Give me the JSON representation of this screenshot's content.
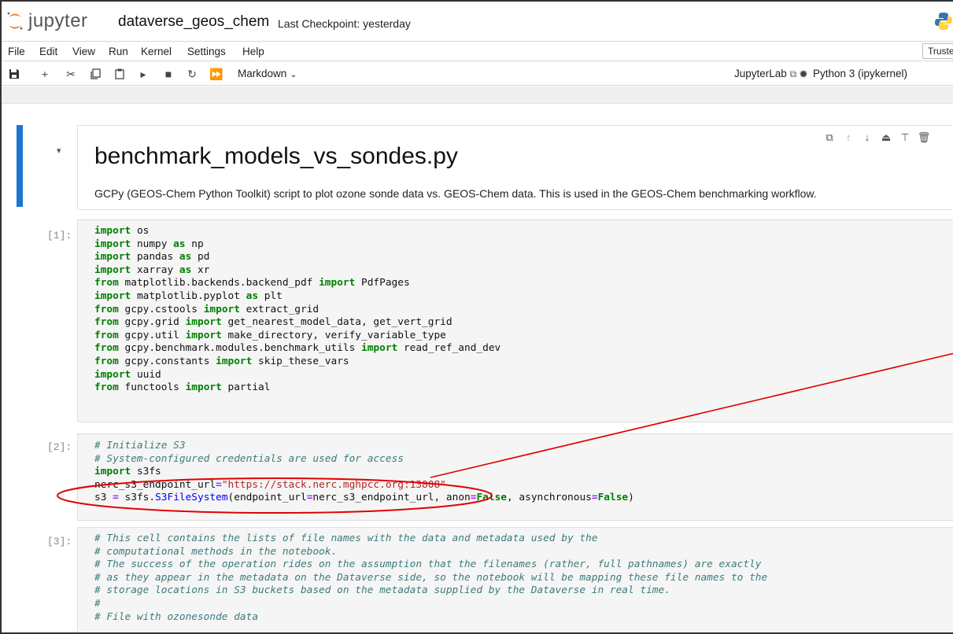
{
  "header": {
    "logo_text": "jupyter",
    "notebook_title": "dataverse_geos_chem",
    "checkpoint": "Last Checkpoint: yesterday"
  },
  "menu": {
    "items": [
      "File",
      "Edit",
      "View",
      "Run",
      "Kernel",
      "Settings",
      "Help"
    ],
    "trusted_label": "Truste"
  },
  "toolbar": {
    "cell_type": "Markdown",
    "jupyterlab_label": "JupyterLab",
    "kernel_label": "Python 3 (ipykernel)"
  },
  "markdown_cell": {
    "heading": "benchmark_models_vs_sondes.py",
    "paragraph": "GCPy (GEOS-Chem Python Toolkit) script to plot ozone sonde data vs. GEOS-Chem data. This is used in the GEOS-Chem benchmarking workflow."
  },
  "cells": [
    {
      "prompt": "[1]:",
      "lines": [
        [
          [
            "kw",
            "import"
          ],
          [
            "t",
            " os"
          ]
        ],
        [
          [
            "kw",
            "import"
          ],
          [
            "t",
            " numpy "
          ],
          [
            "kw",
            "as"
          ],
          [
            "t",
            " np"
          ]
        ],
        [
          [
            "kw",
            "import"
          ],
          [
            "t",
            " pandas "
          ],
          [
            "kw",
            "as"
          ],
          [
            "t",
            " pd"
          ]
        ],
        [
          [
            "kw",
            "import"
          ],
          [
            "t",
            " xarray "
          ],
          [
            "kw",
            "as"
          ],
          [
            "t",
            " xr"
          ]
        ],
        [
          [
            "kw",
            "from"
          ],
          [
            "t",
            " matplotlib.backends.backend_pdf "
          ],
          [
            "kw",
            "import"
          ],
          [
            "t",
            " PdfPages"
          ]
        ],
        [
          [
            "kw",
            "import"
          ],
          [
            "t",
            " matplotlib.pyplot "
          ],
          [
            "kw",
            "as"
          ],
          [
            "t",
            " plt"
          ]
        ],
        [
          [
            "kw",
            "from"
          ],
          [
            "t",
            " gcpy.cstools "
          ],
          [
            "kw",
            "import"
          ],
          [
            "t",
            " extract_grid"
          ]
        ],
        [
          [
            "kw",
            "from"
          ],
          [
            "t",
            " gcpy.grid "
          ],
          [
            "kw",
            "import"
          ],
          [
            "t",
            " get_nearest_model_data, get_vert_grid"
          ]
        ],
        [
          [
            "kw",
            "from"
          ],
          [
            "t",
            " gcpy.util "
          ],
          [
            "kw",
            "import"
          ],
          [
            "t",
            " make_directory, verify_variable_type"
          ]
        ],
        [
          [
            "kw",
            "from"
          ],
          [
            "t",
            " gcpy.benchmark.modules.benchmark_utils "
          ],
          [
            "kw",
            "import"
          ],
          [
            "t",
            " read_ref_and_dev"
          ]
        ],
        [
          [
            "kw",
            "from"
          ],
          [
            "t",
            " gcpy.constants "
          ],
          [
            "kw",
            "import"
          ],
          [
            "t",
            " skip_these_vars"
          ]
        ],
        [
          [
            "kw",
            "import"
          ],
          [
            "t",
            " uuid"
          ]
        ],
        [
          [
            "kw",
            "from"
          ],
          [
            "t",
            " functools "
          ],
          [
            "kw",
            "import"
          ],
          [
            "t",
            " partial"
          ]
        ]
      ]
    },
    {
      "prompt": "[2]:",
      "lines": [
        [
          [
            "cm",
            "# Initialize S3"
          ]
        ],
        [
          [
            "cm",
            "# System-configured credentials are used for access"
          ]
        ],
        [
          [
            "kw",
            "import"
          ],
          [
            "t",
            " s3fs"
          ]
        ],
        [
          [
            "t",
            "nerc_s3_endpoint_url"
          ],
          [
            "op",
            "="
          ],
          [
            "st",
            "\"https://stack.nerc.mghpcc.org:13808\""
          ]
        ],
        [
          [
            "t",
            "s3 "
          ],
          [
            "op",
            "="
          ],
          [
            "t",
            " s3fs."
          ],
          [
            "cls",
            "S3FileSystem"
          ],
          [
            "t",
            "(endpoint_url"
          ],
          [
            "op",
            "="
          ],
          [
            "t",
            "nerc_s3_endpoint_url, anon"
          ],
          [
            "op",
            "="
          ],
          [
            "kw",
            "False"
          ],
          [
            "t",
            ", asynchronous"
          ],
          [
            "op",
            "="
          ],
          [
            "kw",
            "False"
          ],
          [
            "t",
            ")"
          ]
        ]
      ]
    },
    {
      "prompt": "[3]:",
      "lines": [
        [
          [
            "cm",
            "# This cell contains the lists of file names with the data and metadata used by the"
          ]
        ],
        [
          [
            "cm",
            "# computational methods in the notebook."
          ]
        ],
        [
          [
            "cm",
            "# The success of the operation rides on the assumption that the filenames (rather, full pathnames) are exactly"
          ]
        ],
        [
          [
            "cm",
            "# as they appear in the metadata on the Dataverse side, so the notebook will be mapping these file names to the"
          ]
        ],
        [
          [
            "cm",
            "# storage locations in S3 buckets based on the metadata supplied by the Dataverse in real time."
          ]
        ],
        [
          [
            "cm",
            "#"
          ]
        ],
        [
          [
            "cm",
            "# File with ozonesonde data"
          ]
        ]
      ]
    }
  ],
  "colors": {
    "accent": "#1976d2",
    "annotation": "#e00000",
    "keyword": "#008000",
    "string": "#ba2121",
    "comment": "#3d7b7b"
  }
}
